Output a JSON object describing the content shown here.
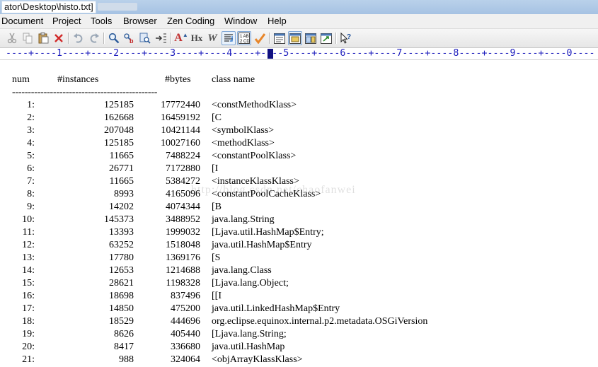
{
  "window": {
    "title": "ator\\Desktop\\histo.txt]"
  },
  "menu": [
    "Document",
    "Project",
    "Tools",
    "Browser",
    "Zen Coding",
    "Window",
    "Help"
  ],
  "toolbar": {
    "buttons": [
      "cut-icon",
      "copy-icon",
      "paste-icon",
      "delete-icon",
      "undo-icon",
      "redo-icon",
      "find-icon",
      "replace-icon",
      "find-in-files-icon",
      "insert-tab-icon",
      "font-size-icon",
      "hx-icon",
      "italic-w-icon",
      "word-wrap-icon",
      "line-numbers-icon",
      "spell-check-icon",
      "view-mode-1-icon",
      "view-mode-2-icon",
      "view-mode-3-icon",
      "browser-preview-icon",
      "help-cursor-icon"
    ],
    "hx_label": "Hx",
    "w_label": "W",
    "font_label": "A"
  },
  "ruler": {
    "text": "----+----1----+----2----+----3----+----4----+----5----+----6----+----7----+----8----+----9----+----0----"
  },
  "editor": {
    "header": {
      "num": "num",
      "instances": "#instances",
      "bytes": "#bytes",
      "class": "class name"
    },
    "separator": "----------------------------------------------",
    "watermark": "http://blog.csdn.net/chaofanwei",
    "rows": [
      {
        "num": "1:",
        "instances": "125185",
        "bytes": "17772440",
        "class": "<constMethodKlass>"
      },
      {
        "num": "2:",
        "instances": "162668",
        "bytes": "16459192",
        "class": "[C"
      },
      {
        "num": "3:",
        "instances": "207048",
        "bytes": "10421144",
        "class": "<symbolKlass>"
      },
      {
        "num": "4:",
        "instances": "125185",
        "bytes": "10027160",
        "class": "<methodKlass>"
      },
      {
        "num": "5:",
        "instances": "11665",
        "bytes": "7488224",
        "class": "<constantPoolKlass>"
      },
      {
        "num": "6:",
        "instances": "26771",
        "bytes": "7172880",
        "class": "[I"
      },
      {
        "num": "7:",
        "instances": "11665",
        "bytes": "5384272",
        "class": "<instanceKlassKlass>"
      },
      {
        "num": "8:",
        "instances": "8993",
        "bytes": "4165096",
        "class": "<constantPoolCacheKlass>"
      },
      {
        "num": "9:",
        "instances": "14202",
        "bytes": "4074344",
        "class": "[B"
      },
      {
        "num": "10:",
        "instances": "145373",
        "bytes": "3488952",
        "class": "java.lang.String"
      },
      {
        "num": "11:",
        "instances": "13393",
        "bytes": "1999032",
        "class": "[Ljava.util.HashMap$Entry;"
      },
      {
        "num": "12:",
        "instances": "63252",
        "bytes": "1518048",
        "class": "java.util.HashMap$Entry"
      },
      {
        "num": "13:",
        "instances": "17780",
        "bytes": "1369176",
        "class": "[S"
      },
      {
        "num": "14:",
        "instances": "12653",
        "bytes": "1214688",
        "class": "java.lang.Class"
      },
      {
        "num": "15:",
        "instances": "28621",
        "bytes": "1198328",
        "class": "[Ljava.lang.Object;"
      },
      {
        "num": "16:",
        "instances": "18698",
        "bytes": "837496",
        "class": "[[I"
      },
      {
        "num": "17:",
        "instances": "14850",
        "bytes": "475200",
        "class": "java.util.LinkedHashMap$Entry"
      },
      {
        "num": "18:",
        "instances": "18529",
        "bytes": "444696",
        "class": "org.eclipse.equinox.internal.p2.metadata.OSGiVersion"
      },
      {
        "num": "19:",
        "instances": "8626",
        "bytes": "405440",
        "class": "[Ljava.lang.String;"
      },
      {
        "num": "20:",
        "instances": "8417",
        "bytes": "336680",
        "class": "java.util.HashMap"
      },
      {
        "num": "21:",
        "instances": "988",
        "bytes": "324064",
        "class": "<objArrayKlassKlass>"
      }
    ]
  },
  "colors": {
    "ruler_text": "#1d1dbd",
    "title_bar": "#b9d1ea",
    "accent_check": "#e8862a"
  }
}
